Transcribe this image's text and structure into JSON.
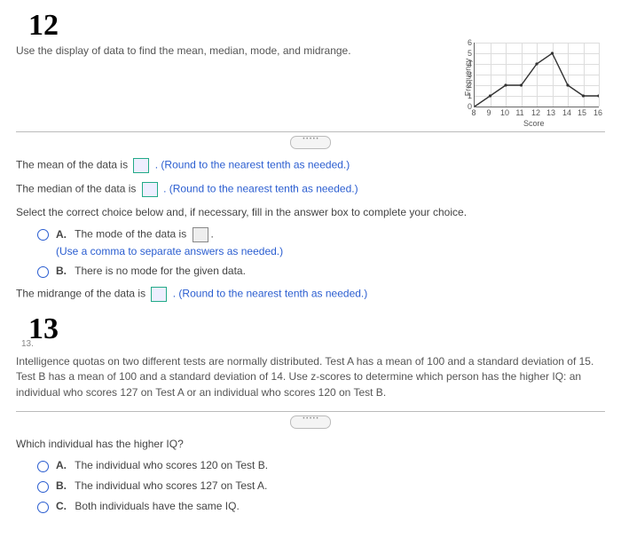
{
  "hand_labels": {
    "q12": "12",
    "q13": "13"
  },
  "q12": {
    "instruction": "Use the display of data to find the mean, median, mode, and midrange.",
    "mean_pre": "The mean of the data is ",
    "mean_hint": ". (Round to the nearest tenth as needed.)",
    "median_pre": "The median of the data is ",
    "median_hint": ". (Round to the nearest tenth as needed.)",
    "select_line": "Select the correct choice below and, if necessary, fill in the answer box to complete your choice.",
    "optA_label": "A.",
    "optA_text": "The mode of the data is ",
    "optA_hint": "(Use a comma to separate answers as needed.)",
    "optB_label": "B.",
    "optB_text": "There is no mode for the given data.",
    "midrange_pre": "The midrange of the data is ",
    "midrange_hint": ". (Round to the nearest tenth as needed.)"
  },
  "chart_data": {
    "type": "line",
    "xlabel": "Score",
    "ylabel": "Frequency",
    "categories": [
      8,
      9,
      10,
      11,
      12,
      13,
      14,
      15,
      16
    ],
    "values": [
      0,
      1,
      2,
      2,
      4,
      5,
      2,
      1,
      1
    ],
    "xlim": [
      8,
      16
    ],
    "ylim": [
      0,
      6
    ]
  },
  "q13": {
    "num_small": "13.",
    "para": "Intelligence quotas on two different tests are normally distributed. Test A has a mean of 100 and a standard deviation of 15. Test B has a mean of 100 and a standard deviation of 14. Use z-scores to determine which person has the higher IQ: an individual who scores 127 on Test A or an individual who scores 120 on Test B.",
    "question": "Which individual has the higher IQ?",
    "optA_label": "A.",
    "optA_text": "The individual who scores 120 on Test B.",
    "optB_label": "B.",
    "optB_text": "The individual who scores 127 on Test A.",
    "optC_label": "C.",
    "optC_text": "Both individuals have the same IQ."
  }
}
